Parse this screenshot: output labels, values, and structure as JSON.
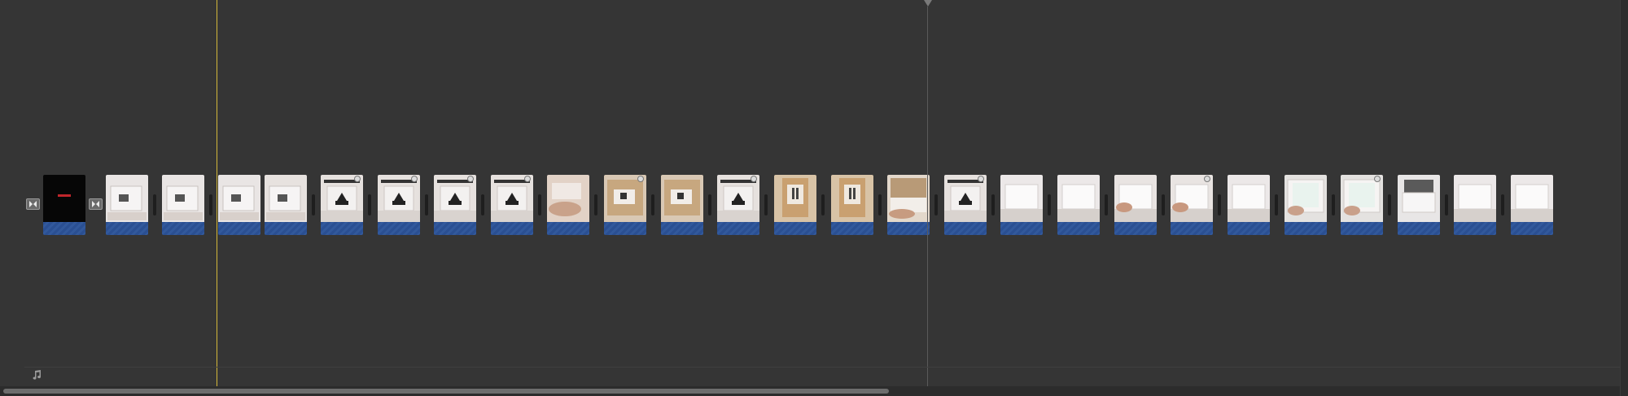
{
  "timeline": {
    "title_clip_text": "",
    "clip_count": 27,
    "playhead_color": "#7a7a7a",
    "skimmer_color": "#d4b83a",
    "audio_color": "#2a4f92"
  },
  "clips": [
    {
      "kind": "title"
    },
    {
      "kind": "box-top"
    },
    {
      "kind": "box-top"
    },
    {
      "kind": "box-top"
    },
    {
      "kind": "box-side"
    },
    {
      "kind": "box-logo",
      "badge": true
    },
    {
      "kind": "box-logo",
      "badge": true
    },
    {
      "kind": "box-logo",
      "badge": true
    },
    {
      "kind": "box-logo",
      "badge": true
    },
    {
      "kind": "hand"
    },
    {
      "kind": "cardboard",
      "badge": true
    },
    {
      "kind": "cardboard"
    },
    {
      "kind": "box-logo",
      "badge": true
    },
    {
      "kind": "cardboard-open"
    },
    {
      "kind": "cardboard-open"
    },
    {
      "kind": "cardboard-hand"
    },
    {
      "kind": "box-logo",
      "badge": true
    },
    {
      "kind": "white-box"
    },
    {
      "kind": "white-box"
    },
    {
      "kind": "white-box-hand"
    },
    {
      "kind": "white-box-hand",
      "badge": true
    },
    {
      "kind": "white-box"
    },
    {
      "kind": "white-box-open"
    },
    {
      "kind": "white-box-open",
      "badge": true
    },
    {
      "kind": "device"
    },
    {
      "kind": "white-box"
    },
    {
      "kind": "white-box"
    }
  ]
}
